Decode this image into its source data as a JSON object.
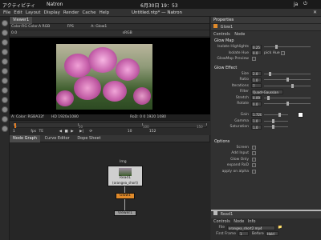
{
  "topbar": {
    "app_menu": "アクティビティ",
    "app_name": "Natron",
    "clock": "6月30日 19：53",
    "lang": "ja"
  },
  "window_title": "Untitled.ntp* — Natron",
  "menu": [
    "File",
    "Edit",
    "Layout",
    "Display",
    "Render",
    "Cache",
    "Help"
  ],
  "viewer": {
    "tab": "Viewer1",
    "row1": "Color:RG Color.A  RGB",
    "fps": "FPS",
    "gain": "0.0",
    "node_a": "A: Glow1",
    "srgb": "sRGB",
    "info_left": "A: Color: RGBA32f",
    "info_hd1": "HD 1920x1080",
    "info_hd2": "RoD: 0 0 1920 1080",
    "ticks": [
      "0",
      "50",
      "100",
      "150"
    ],
    "frame": "1",
    "fps_label": "fps",
    "fps_value": "TE",
    "end_frame": "152"
  },
  "nodegraph": {
    "tabs": [
      "Node Graph",
      "Curve Editor",
      "Dope Sheet"
    ],
    "read_label": "Read1",
    "read_file": "(orangea_short)",
    "img_label": "Img",
    "glow_label": "Glow1",
    "viewer_label": "Viewer1"
  },
  "props": {
    "title": "Properties",
    "node_name": "Glow1",
    "tabs": [
      "Controls",
      "Node"
    ],
    "glow_map": "Glow Map",
    "isolate_highlights": "Isolate Highlights",
    "isolate_highlights_val": "0.25",
    "isolate_hue": "Isolate Hue",
    "isolate_hue_val": "0.0",
    "pick_hue": "pick Hue",
    "glowmap_preview": "GlowMap Preview",
    "glow_effect": "Glow Effect",
    "size": "Size",
    "size_val": "2.0",
    "ratio": "Ratio",
    "ratio_val": "1.0",
    "iterations": "Iterations",
    "iterations_val": "7",
    "filter": "Filter",
    "filter_val": "Quadr-Gaussian",
    "stretch": "Stretch",
    "stretch_val": "0.09",
    "rotate": "Rotate",
    "rotate_val": "0.0",
    "gain": "Gain",
    "gain_val": "1.720",
    "gamma": "Gamma",
    "gamma_val": "1.0",
    "saturation": "Saturation",
    "saturation_val": "1.0",
    "options": "Options",
    "screen": "Screen",
    "add_input": "Add Input",
    "glow_only": "Glow Only",
    "expand_rod": "expand RoD",
    "apply_alpha": "apply on alpha"
  },
  "read_panel": {
    "node_name": "Read1",
    "tabs": [
      "Controls",
      "Node",
      "Info"
    ],
    "file_label": "File",
    "file_value": "orangea_short2.mp4",
    "first_frame": "First Frame",
    "first_frame_val": "1",
    "before": "Before",
    "before_val": "Hold"
  },
  "colors": {
    "accent": "#e07a1f",
    "glow_node": "#e08a2a",
    "read_node": "#b9b9b9",
    "viewer_node": "#9c9c9c"
  }
}
